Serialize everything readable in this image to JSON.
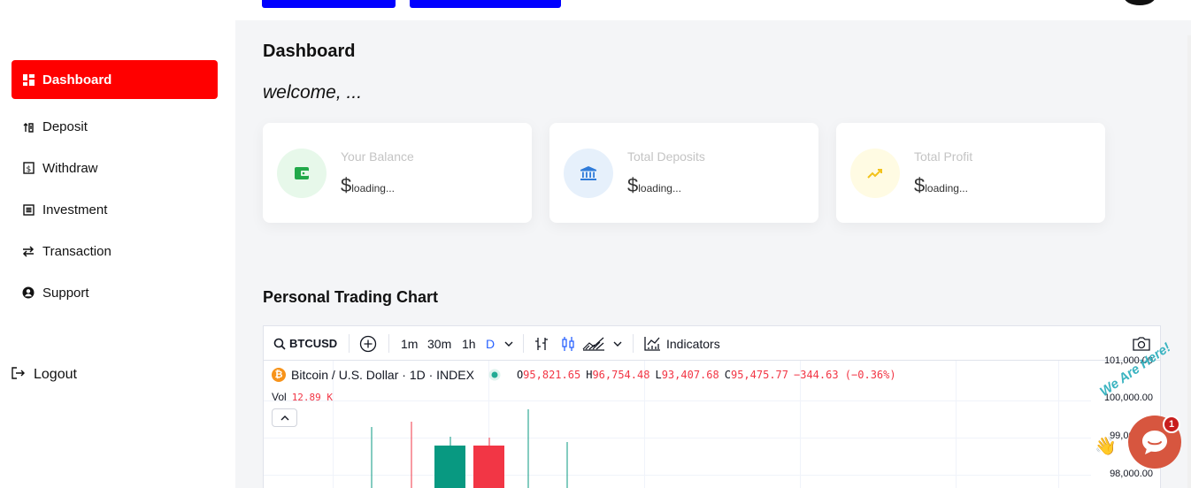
{
  "sidebar": {
    "items": [
      {
        "label": "Dashboard",
        "icon": "dashboard-icon",
        "active": true
      },
      {
        "label": "Deposit",
        "icon": "deposit-icon"
      },
      {
        "label": "Withdraw",
        "icon": "withdraw-icon"
      },
      {
        "label": "Investment",
        "icon": "investment-icon"
      },
      {
        "label": "Transaction",
        "icon": "transaction-icon"
      },
      {
        "label": "Support",
        "icon": "support-icon"
      }
    ],
    "logout_label": "Logout"
  },
  "main": {
    "title": "Dashboard",
    "welcome": "welcome, ...",
    "cards": [
      {
        "label": "Your Balance",
        "currency": "$",
        "value": "loading...",
        "icon": "wallet-icon",
        "color": "#e7f8ea",
        "icon_color": "#22a94a"
      },
      {
        "label": "Total Deposits",
        "currency": "$",
        "value": "loading...",
        "icon": "bank-icon",
        "color": "#e6f0fb",
        "icon_color": "#2f7bd9"
      },
      {
        "label": "Total Profit",
        "currency": "$",
        "value": "loading...",
        "icon": "trending-up-icon",
        "color": "#fffbe3",
        "icon_color": "#f2c21b"
      }
    ],
    "chart_section_title": "Personal Trading Chart"
  },
  "chart_widget": {
    "symbol": "BTCUSD",
    "intervals": [
      "1m",
      "30m",
      "1h",
      "D"
    ],
    "indicators_label": "Indicators",
    "legend": {
      "title": "Bitcoin / U.S. Dollar · 1D · INDEX",
      "o_label": "O",
      "o_value": "95,821.65",
      "h_label": "H",
      "h_value": "96,754.48",
      "l_label": "L",
      "l_value": "93,407.68",
      "c_label": "C",
      "c_value": "95,475.77",
      "change": "−344.63 (−0.36%)"
    },
    "vol_label": "Vol",
    "vol_value": "12.89 K",
    "price_labels": [
      "101,000.00",
      "100,000.00",
      "99,000.00",
      "98,000.00"
    ]
  },
  "chat": {
    "badge": "1",
    "banner": "We Are Here!"
  }
}
